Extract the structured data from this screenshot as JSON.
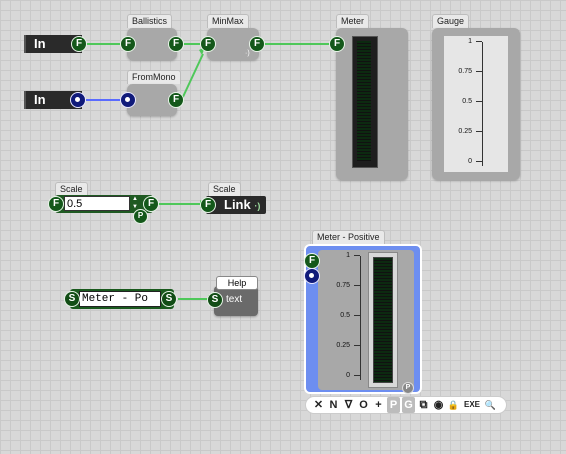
{
  "nodes": {
    "in1": {
      "label": "In",
      "pin": "F"
    },
    "in2": {
      "label": "In"
    },
    "ballistics": {
      "title": "Ballistics",
      "pin_in": "F",
      "pin_out": "F"
    },
    "frommono": {
      "title": "FromMono",
      "pin_out": "F"
    },
    "minmax": {
      "title": "MinMax",
      "pin_in": "F",
      "pin_out": "F"
    },
    "meter": {
      "title": "Meter",
      "pin_in": "F"
    },
    "gauge": {
      "title": "Gauge",
      "ticks": [
        "1",
        "0.75",
        "0.5",
        "0.25",
        "0"
      ]
    },
    "scale_input": {
      "title": "Scale",
      "value": "0.5",
      "pin_in": "F",
      "pin_out": "F",
      "p_badge": "P"
    },
    "scale_link": {
      "title": "Scale",
      "label": "Link",
      "pin_in": "F"
    },
    "text_input": {
      "value": "Meter - Po",
      "pin_in": "S",
      "pin_out": "S"
    },
    "help": {
      "title": "Help",
      "label": "text",
      "pin_in": "S"
    },
    "meter_positive": {
      "title": "Meter - Positive",
      "pin_in": "F",
      "ticks": [
        "1",
        "0.75",
        "0.5",
        "0.25",
        "0"
      ],
      "p_badge": "P"
    }
  },
  "toolbar": {
    "items": [
      "✕",
      "N",
      "∇",
      "O",
      "+",
      "P",
      "G",
      "⧉",
      "◉",
      "🔒",
      "EXE",
      "🔍"
    ]
  },
  "colors": {
    "pin_green": "#14581a",
    "pin_blue": "#101a7a",
    "wire_green": "#4fc85a",
    "wire_blue": "#5a6bff",
    "selection": "#6d8ef0"
  }
}
